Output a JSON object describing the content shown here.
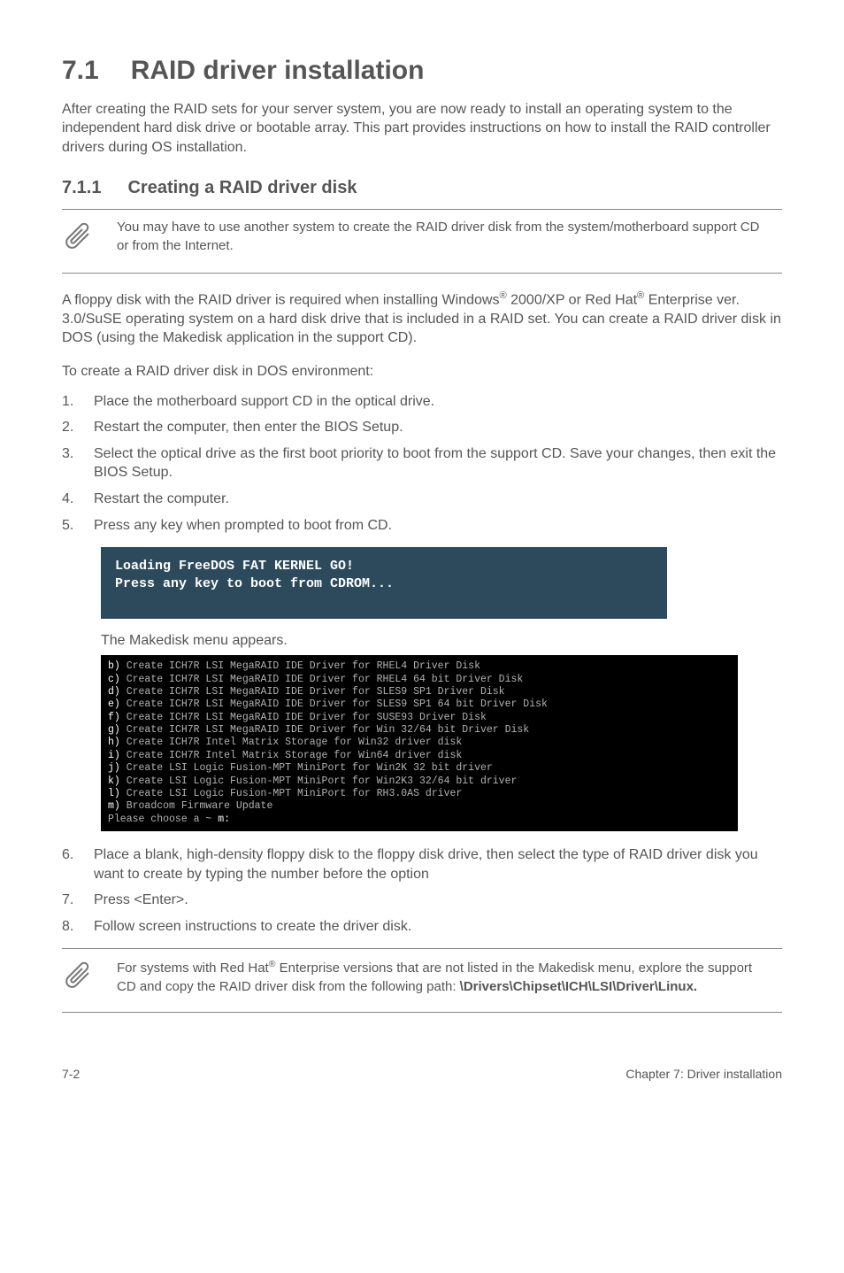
{
  "heading": {
    "num": "7.1",
    "title": "RAID driver installation"
  },
  "intro": "After creating the RAID sets for your server system, you are now ready to install an operating system to the independent hard disk drive or bootable array. This part provides instructions on how to install the RAID controller drivers during OS installation.",
  "subheading": {
    "num": "7.1.1",
    "title": "Creating a RAID driver disk"
  },
  "note1": "You may have to use another system to create the RAID driver disk from the system/motherboard support CD or from the Internet.",
  "body1_a": "A floppy disk with the RAID driver is required when installing Windows",
  "body1_b": " 2000/XP or Red Hat",
  "body1_c": " Enterprise ver. 3.0/SuSE operating system on a hard disk drive that is included in a RAID set. You can create a RAID driver disk in DOS (using the Makedisk application in the support CD).",
  "list_intro": "To create a RAID driver disk in DOS environment:",
  "steps_a": [
    {
      "n": "1.",
      "t": "Place the motherboard support CD in the optical drive."
    },
    {
      "n": "2.",
      "t": "Restart the computer, then enter the BIOS Setup."
    },
    {
      "n": "3.",
      "t": "Select the optical drive as the first boot priority to boot from the support CD. Save your changes, then exit the BIOS Setup."
    },
    {
      "n": "4.",
      "t": "Restart the computer."
    },
    {
      "n": "5.",
      "t": "Press any key when prompted to boot from CD."
    }
  ],
  "terminal_line1": "Loading FreeDOS FAT KERNEL GO!",
  "terminal_line2": "Press any key to boot from CDROM...",
  "caption": "The Makedisk menu appears.",
  "screenshot_lines": [
    {
      "k": "b)",
      "t": " Create ICH7R LSI MegaRAID IDE Driver for RHEL4 Driver Disk"
    },
    {
      "k": "c)",
      "t": " Create ICH7R LSI MegaRAID IDE Driver for RHEL4 64 bit Driver Disk"
    },
    {
      "k": "d)",
      "t": " Create ICH7R LSI MegaRAID IDE Driver for SLES9 SP1 Driver Disk"
    },
    {
      "k": "e)",
      "t": " Create ICH7R LSI MegaRAID IDE Driver for SLES9 SP1 64 bit Driver Disk"
    },
    {
      "k": "f)",
      "t": " Create ICH7R LSI MegaRAID IDE Driver for SUSE93 Driver Disk"
    },
    {
      "k": "g)",
      "t": " Create ICH7R LSI MegaRAID IDE Driver for Win 32/64 bit Driver Disk"
    },
    {
      "k": "h)",
      "t": " Create ICH7R Intel Matrix Storage for Win32 driver disk"
    },
    {
      "k": "i)",
      "t": " Create ICH7R Intel Matrix Storage for Win64 driver disk"
    },
    {
      "k": "j)",
      "t": " Create LSI Logic Fusion-MPT MiniPort for Win2K 32 bit driver"
    },
    {
      "k": "k)",
      "t": " Create LSI Logic Fusion-MPT MiniPort for Win2K3 32/64 bit driver"
    },
    {
      "k": "l)",
      "t": " Create LSI Logic Fusion-MPT MiniPort for RH3.0AS driver"
    },
    {
      "k": "m)",
      "t": " Broadcom Firmware Update"
    }
  ],
  "screenshot_prompt_a": "Please choose a ~ ",
  "screenshot_prompt_b": "m:",
  "steps_b": [
    {
      "n": "6.",
      "t": "Place a blank, high-density floppy disk to the floppy disk drive, then select the type of RAID driver disk you want to create by typing the number before the option"
    },
    {
      "n": "7.",
      "t": "Press <Enter>."
    },
    {
      "n": "8.",
      "t": "Follow screen instructions to create the driver disk."
    }
  ],
  "note2_a": "For systems with Red Hat",
  "note2_b": " Enterprise versions that are not listed in the Makedisk menu, explore the support CD and copy the RAID driver disk from the following path: ",
  "note2_path": "\\Drivers\\Chipset\\ICH\\LSI\\Driver\\Linux.",
  "footer_left": "7-2",
  "footer_right": "Chapter 7: Driver installation"
}
